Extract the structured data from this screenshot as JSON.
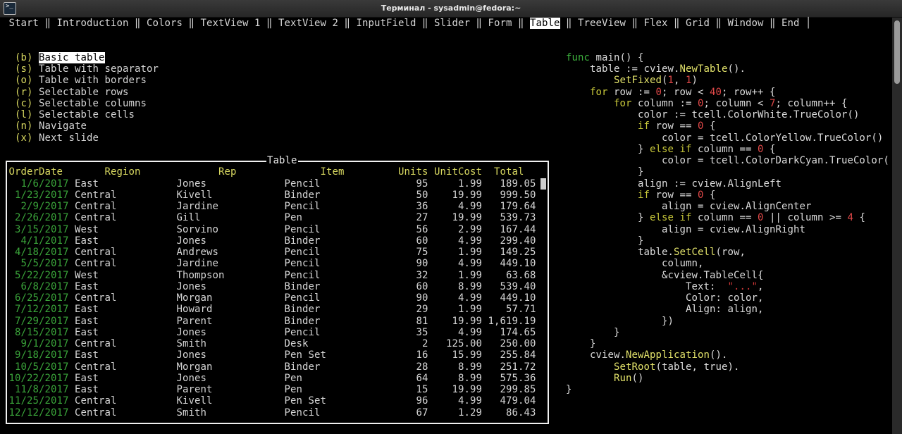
{
  "window": {
    "title": "Терминал - sysadmin@fedora:~",
    "icon": "terminal-icon"
  },
  "tabs": [
    {
      "label": "Start"
    },
    {
      "label": "Introduction"
    },
    {
      "label": "Colors"
    },
    {
      "label": "TextView 1"
    },
    {
      "label": "TextView 2"
    },
    {
      "label": "InputField"
    },
    {
      "label": "Slider"
    },
    {
      "label": "Form"
    },
    {
      "label": "Table",
      "selected": true
    },
    {
      "label": "TreeView"
    },
    {
      "label": "Flex"
    },
    {
      "label": "Grid"
    },
    {
      "label": "Window"
    },
    {
      "label": "End"
    }
  ],
  "menu": [
    {
      "key": "(b)",
      "label": "Basic table",
      "selected": true
    },
    {
      "key": "(s)",
      "label": "Table with separator"
    },
    {
      "key": "(o)",
      "label": "Table with borders"
    },
    {
      "key": "(r)",
      "label": "Selectable rows"
    },
    {
      "key": "(c)",
      "label": "Selectable columns"
    },
    {
      "key": "(l)",
      "label": "Selectable cells"
    },
    {
      "key": "(n)",
      "label": "Navigate"
    },
    {
      "key": "(x)",
      "label": "Next slide"
    }
  ],
  "table": {
    "title": "Table",
    "headers": {
      "date": "OrderDate",
      "region": "Region",
      "rep": "Rep",
      "item": "Item",
      "units": "Units",
      "cost": "UnitCost",
      "total": "Total"
    },
    "rows": [
      {
        "date": "1/6/2017",
        "region": "East",
        "rep": "Jones",
        "item": "Pencil",
        "units": "95",
        "cost": "1.99",
        "total": "189.05"
      },
      {
        "date": "1/23/2017",
        "region": "Central",
        "rep": "Kivell",
        "item": "Binder",
        "units": "50",
        "cost": "19.99",
        "total": "999.50"
      },
      {
        "date": "2/9/2017",
        "region": "Central",
        "rep": "Jardine",
        "item": "Pencil",
        "units": "36",
        "cost": "4.99",
        "total": "179.64"
      },
      {
        "date": "2/26/2017",
        "region": "Central",
        "rep": "Gill",
        "item": "Pen",
        "units": "27",
        "cost": "19.99",
        "total": "539.73"
      },
      {
        "date": "3/15/2017",
        "region": "West",
        "rep": "Sorvino",
        "item": "Pencil",
        "units": "56",
        "cost": "2.99",
        "total": "167.44"
      },
      {
        "date": "4/1/2017",
        "region": "East",
        "rep": "Jones",
        "item": "Binder",
        "units": "60",
        "cost": "4.99",
        "total": "299.40"
      },
      {
        "date": "4/18/2017",
        "region": "Central",
        "rep": "Andrews",
        "item": "Pencil",
        "units": "75",
        "cost": "1.99",
        "total": "149.25"
      },
      {
        "date": "5/5/2017",
        "region": "Central",
        "rep": "Jardine",
        "item": "Pencil",
        "units": "90",
        "cost": "4.99",
        "total": "449.10"
      },
      {
        "date": "5/22/2017",
        "region": "West",
        "rep": "Thompson",
        "item": "Pencil",
        "units": "32",
        "cost": "1.99",
        "total": "63.68"
      },
      {
        "date": "6/8/2017",
        "region": "East",
        "rep": "Jones",
        "item": "Binder",
        "units": "60",
        "cost": "8.99",
        "total": "539.40"
      },
      {
        "date": "6/25/2017",
        "region": "Central",
        "rep": "Morgan",
        "item": "Pencil",
        "units": "90",
        "cost": "4.99",
        "total": "449.10"
      },
      {
        "date": "7/12/2017",
        "region": "East",
        "rep": "Howard",
        "item": "Binder",
        "units": "29",
        "cost": "1.99",
        "total": "57.71"
      },
      {
        "date": "7/29/2017",
        "region": "East",
        "rep": "Parent",
        "item": "Binder",
        "units": "81",
        "cost": "19.99",
        "total": "1,619.19"
      },
      {
        "date": "8/15/2017",
        "region": "East",
        "rep": "Jones",
        "item": "Pencil",
        "units": "35",
        "cost": "4.99",
        "total": "174.65"
      },
      {
        "date": "9/1/2017",
        "region": "Central",
        "rep": "Smith",
        "item": "Desk",
        "units": "2",
        "cost": "125.00",
        "total": "250.00"
      },
      {
        "date": "9/18/2017",
        "region": "East",
        "rep": "Jones",
        "item": "Pen Set",
        "units": "16",
        "cost": "15.99",
        "total": "255.84"
      },
      {
        "date": "10/5/2017",
        "region": "Central",
        "rep": "Morgan",
        "item": "Binder",
        "units": "28",
        "cost": "8.99",
        "total": "251.72"
      },
      {
        "date": "10/22/2017",
        "region": "East",
        "rep": "Jones",
        "item": "Pen",
        "units": "64",
        "cost": "8.99",
        "total": "575.36"
      },
      {
        "date": "11/8/2017",
        "region": "East",
        "rep": "Parent",
        "item": "Pen",
        "units": "15",
        "cost": "19.99",
        "total": "299.85"
      },
      {
        "date": "11/25/2017",
        "region": "Central",
        "rep": "Kivell",
        "item": "Pen Set",
        "units": "96",
        "cost": "4.99",
        "total": "479.04"
      },
      {
        "date": "12/12/2017",
        "region": "Central",
        "rep": "Smith",
        "item": "Pencil",
        "units": "67",
        "cost": "1.29",
        "total": "86.43"
      }
    ]
  },
  "code": {
    "lines": [
      [
        {
          "t": "func",
          "k": "func"
        },
        {
          "t": " main() {",
          "k": "t"
        }
      ],
      [
        {
          "t": "    table := cview.",
          "k": "t"
        },
        {
          "t": "NewTable",
          "k": "fn"
        },
        {
          "t": "().",
          "k": "t"
        }
      ],
      [
        {
          "t": "        ",
          "k": "t"
        },
        {
          "t": "SetFixed",
          "k": "fn"
        },
        {
          "t": "(",
          "k": "t"
        },
        {
          "t": "1",
          "k": "num"
        },
        {
          "t": ", ",
          "k": "t"
        },
        {
          "t": "1",
          "k": "num"
        },
        {
          "t": ")",
          "k": "t"
        }
      ],
      [
        {
          "t": "    ",
          "k": "t"
        },
        {
          "t": "for",
          "k": "kw"
        },
        {
          "t": " row := ",
          "k": "t"
        },
        {
          "t": "0",
          "k": "num"
        },
        {
          "t": "; row < ",
          "k": "t"
        },
        {
          "t": "40",
          "k": "num"
        },
        {
          "t": "; row++ {",
          "k": "t"
        }
      ],
      [
        {
          "t": "        ",
          "k": "t"
        },
        {
          "t": "for",
          "k": "kw"
        },
        {
          "t": " column := ",
          "k": "t"
        },
        {
          "t": "0",
          "k": "num"
        },
        {
          "t": "; column < ",
          "k": "t"
        },
        {
          "t": "7",
          "k": "num"
        },
        {
          "t": "; column++ {",
          "k": "t"
        }
      ],
      [
        {
          "t": "            color := tcell.ColorWhite.TrueColor()",
          "k": "t"
        }
      ],
      [
        {
          "t": "            ",
          "k": "t"
        },
        {
          "t": "if",
          "k": "kw"
        },
        {
          "t": " row == ",
          "k": "t"
        },
        {
          "t": "0",
          "k": "num"
        },
        {
          "t": " {",
          "k": "t"
        }
      ],
      [
        {
          "t": "                color = tcell.ColorYellow.TrueColor()",
          "k": "t"
        }
      ],
      [
        {
          "t": "            } ",
          "k": "t"
        },
        {
          "t": "else if",
          "k": "kw"
        },
        {
          "t": " column == ",
          "k": "t"
        },
        {
          "t": "0",
          "k": "num"
        },
        {
          "t": " {",
          "k": "t"
        }
      ],
      [
        {
          "t": "                color = tcell.ColorDarkCyan.TrueColor(",
          "k": "t"
        }
      ],
      [
        {
          "t": "            }",
          "k": "t"
        }
      ],
      [
        {
          "t": "            align := cview.AlignLeft",
          "k": "t"
        }
      ],
      [
        {
          "t": "            ",
          "k": "t"
        },
        {
          "t": "if",
          "k": "kw"
        },
        {
          "t": " row == ",
          "k": "t"
        },
        {
          "t": "0",
          "k": "num"
        },
        {
          "t": " {",
          "k": "t"
        }
      ],
      [
        {
          "t": "                align = cview.AlignCenter",
          "k": "t"
        }
      ],
      [
        {
          "t": "            } ",
          "k": "t"
        },
        {
          "t": "else if",
          "k": "kw"
        },
        {
          "t": " column == ",
          "k": "t"
        },
        {
          "t": "0",
          "k": "num"
        },
        {
          "t": " || column >= ",
          "k": "t"
        },
        {
          "t": "4",
          "k": "num"
        },
        {
          "t": " {",
          "k": "t"
        }
      ],
      [
        {
          "t": "                align = cview.AlignRight",
          "k": "t"
        }
      ],
      [
        {
          "t": "            }",
          "k": "t"
        }
      ],
      [
        {
          "t": "            table.",
          "k": "t"
        },
        {
          "t": "SetCell",
          "k": "fn"
        },
        {
          "t": "(row,",
          "k": "t"
        }
      ],
      [
        {
          "t": "                column,",
          "k": "t"
        }
      ],
      [
        {
          "t": "                &cview.TableCell{",
          "k": "t"
        }
      ],
      [
        {
          "t": "                    Text:  ",
          "k": "t"
        },
        {
          "t": "\"...\"",
          "k": "str"
        },
        {
          "t": ",",
          "k": "t"
        }
      ],
      [
        {
          "t": "                    Color: color,",
          "k": "t"
        }
      ],
      [
        {
          "t": "                    Align: align,",
          "k": "t"
        }
      ],
      [
        {
          "t": "                })",
          "k": "t"
        }
      ],
      [
        {
          "t": "        }",
          "k": "t"
        }
      ],
      [
        {
          "t": "    }",
          "k": "t"
        }
      ],
      [
        {
          "t": "    cview.",
          "k": "t"
        },
        {
          "t": "NewApplication",
          "k": "fn"
        },
        {
          "t": "().",
          "k": "t"
        }
      ],
      [
        {
          "t": "        ",
          "k": "t"
        },
        {
          "t": "SetRoot",
          "k": "fn"
        },
        {
          "t": "(table, true).",
          "k": "t"
        }
      ],
      [
        {
          "t": "        ",
          "k": "t"
        },
        {
          "t": "Run",
          "k": "fn"
        },
        {
          "t": "()",
          "k": "t"
        }
      ],
      [
        {
          "t": "}",
          "k": "t"
        }
      ]
    ]
  }
}
